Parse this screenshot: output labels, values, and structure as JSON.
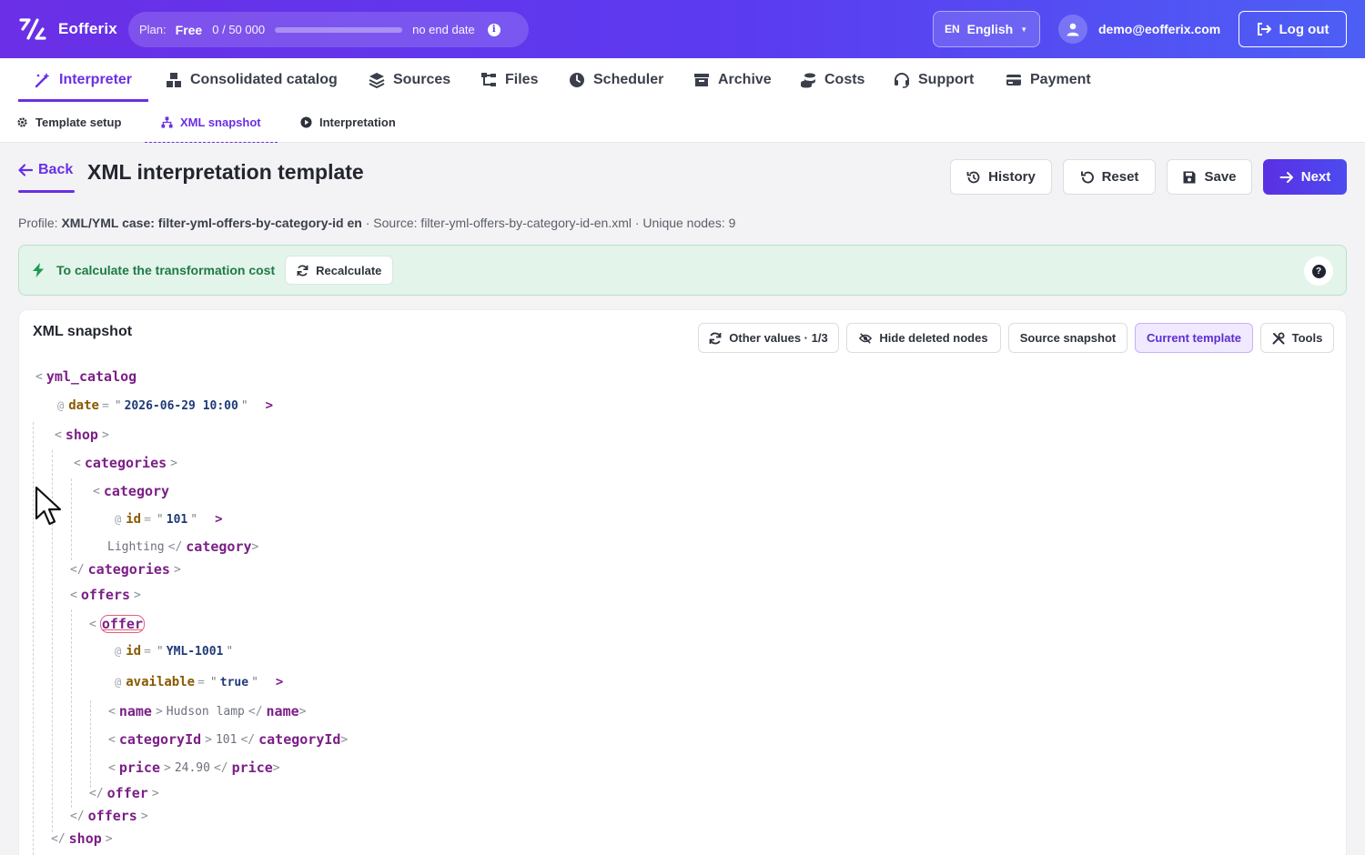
{
  "app": {
    "name": "Eofferix"
  },
  "plan": {
    "label": "Plan:",
    "name": "Free",
    "used": "0",
    "separator": "/",
    "limit": "50 000",
    "usage_fraction": 0.0,
    "end": "no end date"
  },
  "language": {
    "code": "EN",
    "name": "English"
  },
  "user": {
    "email": "demo@eofferix.com",
    "logout_label": "Log out"
  },
  "nav": [
    {
      "label": "Interpreter",
      "icon": "wand-icon",
      "active": true
    },
    {
      "label": "Consolidated catalog",
      "icon": "cubes-icon"
    },
    {
      "label": "Sources",
      "icon": "layers-icon"
    },
    {
      "label": "Files",
      "icon": "sitemap-icon"
    },
    {
      "label": "Scheduler",
      "icon": "clock-icon"
    },
    {
      "label": "Archive",
      "icon": "archive-icon"
    },
    {
      "label": "Costs",
      "icon": "coins-icon"
    },
    {
      "label": "Support",
      "icon": "headset-icon"
    },
    {
      "label": "Payment",
      "icon": "card-icon"
    }
  ],
  "subnav": [
    {
      "label": "Template setup",
      "icon": "gear-icon"
    },
    {
      "label": "XML snapshot",
      "icon": "tree-icon",
      "active": true
    },
    {
      "label": "Interpretation",
      "icon": "play-icon"
    }
  ],
  "header": {
    "back_label": "Back",
    "title": "XML interpretation template",
    "buttons": {
      "history": "History",
      "reset": "Reset",
      "save": "Save",
      "next": "Next"
    }
  },
  "profile": {
    "profile_label": "Profile:",
    "profile_value": "XML/YML case: filter-yml-offers-by-category-id en",
    "source_text": " · Source: filter-yml-offers-by-category-id-en.xml · Unique nodes: 9"
  },
  "notice": {
    "text": "To calculate the transformation cost",
    "button": "Recalculate"
  },
  "snapshot": {
    "title": "XML snapshot",
    "tools": {
      "other_values": "Other values · 1/3",
      "hide_deleted": "Hide deleted nodes",
      "source_snapshot": "Source snapshot",
      "current_template": "Current template",
      "tools": "Tools"
    },
    "tags": {
      "root": "yml_catalog",
      "shop": "shop",
      "categories": "categories",
      "category": "category",
      "offers": "offers",
      "offer": "offer",
      "name": "name",
      "categoryId": "categoryId",
      "price": "price"
    },
    "attrs": {
      "date_name": "date",
      "date_value": "2026-06-29 10:00",
      "cat_id_name": "id",
      "cat_id_value": "101",
      "offer_id_name": "id",
      "offer_id_value": "YML-1001",
      "available_name": "available",
      "available_value": "true"
    },
    "texts": {
      "category_text": "Lighting",
      "name_text": "Hudson lamp",
      "categoryId_text": "101",
      "price_text": "24.90"
    }
  },
  "colors": {
    "accent": "#6a2fe6",
    "success": "#1e7a45",
    "tag": "#7b1f86",
    "attr": "#8a5a00",
    "value": "#1f3a78"
  }
}
